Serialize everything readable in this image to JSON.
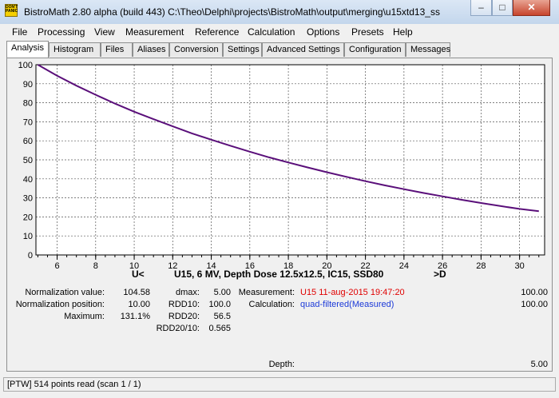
{
  "titlebar": {
    "icon_text": "DON'T PANIC",
    "title": "BistroMath 2.80 alpha (build 443)   C:\\Theo\\Delphi\\projects\\BistroMath\\output\\merging\\u15xtd13_ss"
  },
  "window_buttons": {
    "minimize": "–",
    "maximize": "□",
    "close": "✕"
  },
  "menu": [
    "File",
    "Processing",
    "View",
    "Measurement",
    "Reference",
    "Calculation",
    "Options",
    "Presets",
    "Help"
  ],
  "tabs": [
    "Analysis",
    "Histogram",
    "Files",
    "Aliases",
    "Conversion",
    "Settings",
    "Advanced Settings",
    "Configuration",
    "Messages"
  ],
  "chart_data": {
    "type": "line",
    "xlim": [
      4.9,
      31.3
    ],
    "ylim": [
      0,
      100
    ],
    "x_ticks": [
      6,
      8,
      10,
      12,
      14,
      16,
      18,
      20,
      22,
      24,
      26,
      28,
      30
    ],
    "y_ticks": [
      0,
      10,
      20,
      30,
      40,
      50,
      60,
      70,
      80,
      90,
      100
    ],
    "grid": true,
    "series": [
      {
        "color": "#5a0f7a",
        "x": [
          5.0,
          6,
          7,
          8,
          9,
          10,
          11,
          12,
          13,
          14,
          15,
          16,
          17,
          18,
          19,
          20,
          21,
          22,
          23,
          24,
          25,
          26,
          27,
          28,
          29,
          30,
          31.0
        ],
        "y": [
          100.0,
          94.2,
          89.0,
          84.2,
          79.6,
          75.3,
          71.4,
          67.6,
          63.9,
          60.6,
          57.4,
          54.3,
          51.3,
          48.6,
          46.0,
          43.5,
          41.1,
          38.8,
          36.6,
          34.6,
          32.6,
          30.8,
          29.0,
          27.3,
          25.7,
          24.2,
          23.0
        ]
      }
    ]
  },
  "chart_footer": {
    "left_label": "U<",
    "title": "U15, 6 MV, Depth Dose 12.5x12.5, IC15, SSD80",
    "right_label": ">D"
  },
  "info": {
    "normalization_value_label": "Normalization value:",
    "normalization_value": "104.58",
    "normalization_position_label": "Normalization position:",
    "normalization_position": "10.00",
    "maximum_label": "Maximum:",
    "maximum": "131.1%",
    "dmax_label": "dmax:",
    "dmax": "5.00",
    "rdd10_label": "RDD10:",
    "rdd10": "100.0",
    "rdd20_label": "RDD20:",
    "rdd20": "56.5",
    "rdd2010_label": "RDD20/10:",
    "rdd2010": "0.565",
    "measurement_label": "Measurement:",
    "measurement_value": "U15 11-aug-2015 19:47:20",
    "measurement_pct": "100.00",
    "calculation_label": "Calculation:",
    "calculation_value": "quad-filtered(Measured)",
    "calculation_pct": "100.00",
    "depth_label": "Depth:",
    "depth_value": "5.00"
  },
  "status": "[PTW] 514 points read (scan 1 / 1)"
}
